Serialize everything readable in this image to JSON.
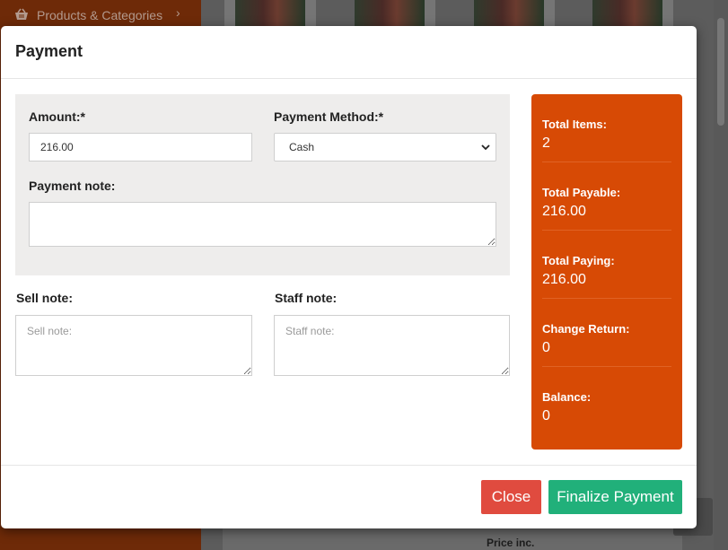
{
  "background": {
    "sidebar_item_label": "Products & Categories",
    "footer_text": "Price inc."
  },
  "modal": {
    "title": "Payment",
    "amount": {
      "label": "Amount:*",
      "value": "216.00"
    },
    "payment_method": {
      "label": "Payment Method:*",
      "selected": "Cash"
    },
    "payment_note": {
      "label": "Payment note:",
      "value": ""
    },
    "sell_note": {
      "label": "Sell note:",
      "placeholder": "Sell note:"
    },
    "staff_note": {
      "label": "Staff note:",
      "placeholder": "Staff note:"
    },
    "summary": [
      {
        "label": "Total Items:",
        "value": "2"
      },
      {
        "label": "Total Payable:",
        "value": "216.00"
      },
      {
        "label": "Total Paying:",
        "value": "216.00"
      },
      {
        "label": "Change Return:",
        "value": "0"
      },
      {
        "label": "Balance:",
        "value": "0"
      }
    ],
    "buttons": {
      "close": "Close",
      "finalize": "Finalize Payment"
    }
  },
  "colors": {
    "summary_bg": "#d74a05",
    "close_button": "#e04b3f",
    "finalize_button": "#21b07a"
  },
  "icons": [
    "basket-icon",
    "chevron-right-icon",
    "chevron-down-icon"
  ]
}
